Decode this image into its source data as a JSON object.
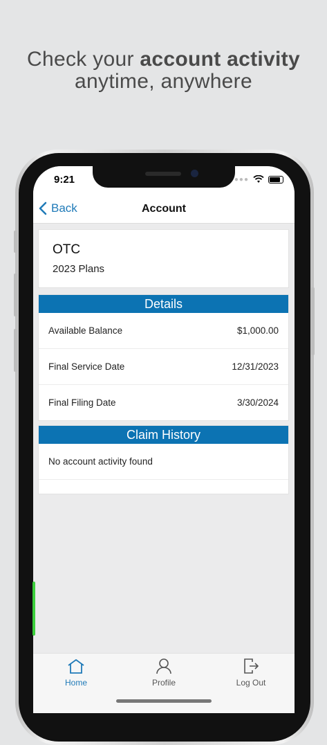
{
  "promo": {
    "line1_prefix": "Check your ",
    "line1_bold": "account activity",
    "line2": "anytime, anywhere"
  },
  "status_bar": {
    "time": "9:21"
  },
  "nav": {
    "back_label": "Back",
    "title": "Account"
  },
  "plan": {
    "name": "OTC",
    "subtitle": "2023 Plans"
  },
  "details": {
    "header": "Details",
    "rows": [
      {
        "label": "Available Balance",
        "value": "$1,000.00"
      },
      {
        "label": "Final Service Date",
        "value": "12/31/2023"
      },
      {
        "label": "Final Filing Date",
        "value": "3/30/2024"
      }
    ]
  },
  "claims": {
    "header": "Claim History",
    "empty_message": "No account activity found"
  },
  "tabbar": {
    "items": [
      {
        "label": "Home",
        "icon": "home-icon",
        "active": true
      },
      {
        "label": "Profile",
        "icon": "profile-icon",
        "active": false
      },
      {
        "label": "Log Out",
        "icon": "logout-icon",
        "active": false
      }
    ]
  },
  "colors": {
    "accent": "#1f7ab8",
    "section_header": "#0c73b3",
    "background": "#e4e5e6"
  }
}
